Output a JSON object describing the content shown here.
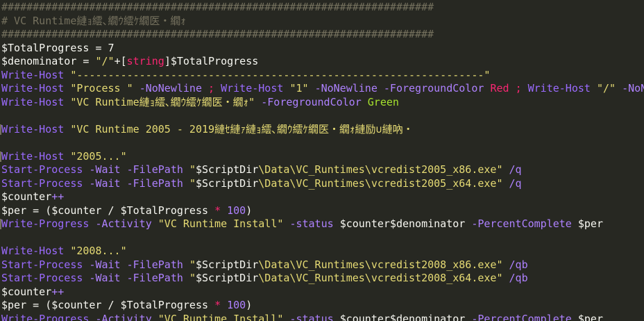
{
  "editor": {
    "lines": [
      [
        {
          "t": "#####################################################################",
          "c": "comment"
        }
      ],
      [
        {
          "t": "# VC Runtime縺ｮ繧､繝ｳ繧ｹ繝医・繝ｫ",
          "c": "comment"
        }
      ],
      [
        {
          "t": "#####################################################################",
          "c": "comment"
        }
      ],
      [
        {
          "t": "$TotalProgress = 7",
          "c": "var"
        }
      ],
      [
        {
          "t": "$denominator = ",
          "c": "var"
        },
        {
          "t": "\"/\"",
          "c": "str"
        },
        {
          "t": "+",
          "c": "op"
        },
        {
          "t": "[",
          "c": "op"
        },
        {
          "t": "string",
          "c": "type"
        },
        {
          "t": "]",
          "c": "op"
        },
        {
          "t": "$TotalProgress",
          "c": "var"
        }
      ],
      [
        {
          "t": "Write-Host ",
          "c": "cmd"
        },
        {
          "t": "\"-----------------------------------------------------------------\"",
          "c": "str"
        }
      ],
      [
        {
          "t": "Write-Host ",
          "c": "cmd"
        },
        {
          "t": "\"Process \" ",
          "c": "str"
        },
        {
          "t": "-NoNewline ",
          "c": "param"
        },
        {
          "t": "; ",
          "c": "red"
        },
        {
          "t": "Write-Host ",
          "c": "cmd"
        },
        {
          "t": "\"1\" ",
          "c": "str"
        },
        {
          "t": "-NoNewline -ForegroundColor ",
          "c": "param"
        },
        {
          "t": "Red ",
          "c": "red"
        },
        {
          "t": "; ",
          "c": "red"
        },
        {
          "t": "Write-Host ",
          "c": "cmd"
        },
        {
          "t": "\"/\" ",
          "c": "str"
        },
        {
          "t": "-NoNe",
          "c": "param"
        }
      ],
      [
        {
          "t": "Write-Host ",
          "c": "cmd"
        },
        {
          "t": "\"VC Runtime縺ｮ繧､繝ｳ繧ｹ繝医・繝ｫ\" ",
          "c": "str"
        },
        {
          "t": "-ForegroundColor ",
          "c": "param"
        },
        {
          "t": "Green",
          "c": "green"
        }
      ],
      [
        {
          "t": "",
          "c": "var"
        }
      ],
      [
        {
          "t": "Write-Host ",
          "c": "cmd"
        },
        {
          "t": "\"VC Runtime 2005 - 2019縺ｾ縺ｧ縺ｮ繧､繝ｳ繧ｹ繝医・繝ｫ縺励∪縺吶・",
          "c": "str"
        }
      ],
      [
        {
          "t": "",
          "c": "var"
        }
      ],
      [
        {
          "t": "Write-Host ",
          "c": "cmd"
        },
        {
          "t": "\"2005...\"",
          "c": "str"
        }
      ],
      [
        {
          "t": "Start-Process ",
          "c": "cmd"
        },
        {
          "t": "-Wait -FilePath ",
          "c": "param"
        },
        {
          "t": "\"",
          "c": "str"
        },
        {
          "t": "$ScriptDir",
          "c": "var"
        },
        {
          "t": "\\Data\\VC_Runtimes\\vcredist2005_x86.exe\" ",
          "c": "str"
        },
        {
          "t": "/q",
          "c": "param"
        }
      ],
      [
        {
          "t": "Start-Process ",
          "c": "cmd"
        },
        {
          "t": "-Wait -FilePath ",
          "c": "param"
        },
        {
          "t": "\"",
          "c": "str"
        },
        {
          "t": "$ScriptDir",
          "c": "var"
        },
        {
          "t": "\\Data\\VC_Runtimes\\vcredist2005_x64.exe\" ",
          "c": "str"
        },
        {
          "t": "/q",
          "c": "param"
        }
      ],
      [
        {
          "t": "$counter",
          "c": "var"
        },
        {
          "t": "++",
          "c": "num"
        }
      ],
      [
        {
          "t": "$per = (",
          "c": "var"
        },
        {
          "t": "$counter ",
          "c": "var"
        },
        {
          "t": "/ ",
          "c": "op"
        },
        {
          "t": "$TotalProgress ",
          "c": "var"
        },
        {
          "t": "* ",
          "c": "red"
        },
        {
          "t": "100",
          "c": "num"
        },
        {
          "t": ")",
          "c": "var"
        }
      ],
      [
        {
          "t": "Write-Progress ",
          "c": "cmd"
        },
        {
          "t": "-Activity ",
          "c": "param"
        },
        {
          "t": "\"VC Runtime Install\" ",
          "c": "str"
        },
        {
          "t": "-status ",
          "c": "param"
        },
        {
          "t": "$counter$denominator ",
          "c": "var"
        },
        {
          "t": "-PercentComplete ",
          "c": "param"
        },
        {
          "t": "$per",
          "c": "var"
        }
      ],
      [
        {
          "t": "",
          "c": "var"
        }
      ],
      [
        {
          "t": "Write-Host ",
          "c": "cmd"
        },
        {
          "t": "\"2008...\"",
          "c": "str"
        }
      ],
      [
        {
          "t": "Start-Process ",
          "c": "cmd"
        },
        {
          "t": "-Wait -FilePath ",
          "c": "param"
        },
        {
          "t": "\"",
          "c": "str"
        },
        {
          "t": "$ScriptDir",
          "c": "var"
        },
        {
          "t": "\\Data\\VC_Runtimes\\vcredist2008_x86.exe\" ",
          "c": "str"
        },
        {
          "t": "/qb",
          "c": "param"
        }
      ],
      [
        {
          "t": "Start-Process ",
          "c": "cmd"
        },
        {
          "t": "-Wait -FilePath ",
          "c": "param"
        },
        {
          "t": "\"",
          "c": "str"
        },
        {
          "t": "$ScriptDir",
          "c": "var"
        },
        {
          "t": "\\Data\\VC_Runtimes\\vcredist2008_x64.exe\" ",
          "c": "str"
        },
        {
          "t": "/qb",
          "c": "param"
        }
      ],
      [
        {
          "t": "$counter",
          "c": "var"
        },
        {
          "t": "++",
          "c": "num"
        }
      ],
      [
        {
          "t": "$per = (",
          "c": "var"
        },
        {
          "t": "$counter ",
          "c": "var"
        },
        {
          "t": "/ ",
          "c": "op"
        },
        {
          "t": "$TotalProgress ",
          "c": "var"
        },
        {
          "t": "* ",
          "c": "red"
        },
        {
          "t": "100",
          "c": "num"
        },
        {
          "t": ")",
          "c": "var"
        }
      ],
      [
        {
          "t": "Write-Progress ",
          "c": "cmd"
        },
        {
          "t": "-Activity ",
          "c": "param"
        },
        {
          "t": "\"VC Runtime Install\" ",
          "c": "str"
        },
        {
          "t": "-status ",
          "c": "param"
        },
        {
          "t": "$counter$denominator ",
          "c": "var"
        },
        {
          "t": "-PercentComplete ",
          "c": "param"
        },
        {
          "t": "$per",
          "c": "var"
        }
      ]
    ],
    "marked_lines": [
      9,
      11,
      16
    ],
    "colors": {
      "background": "#272822",
      "comment": "#75715e",
      "command": "#9b6bff",
      "string": "#e6db74",
      "parameter": "#ae81ff",
      "variable": "#f8f8f2",
      "keyword_red": "#f92672",
      "green": "#a6e22e"
    }
  }
}
